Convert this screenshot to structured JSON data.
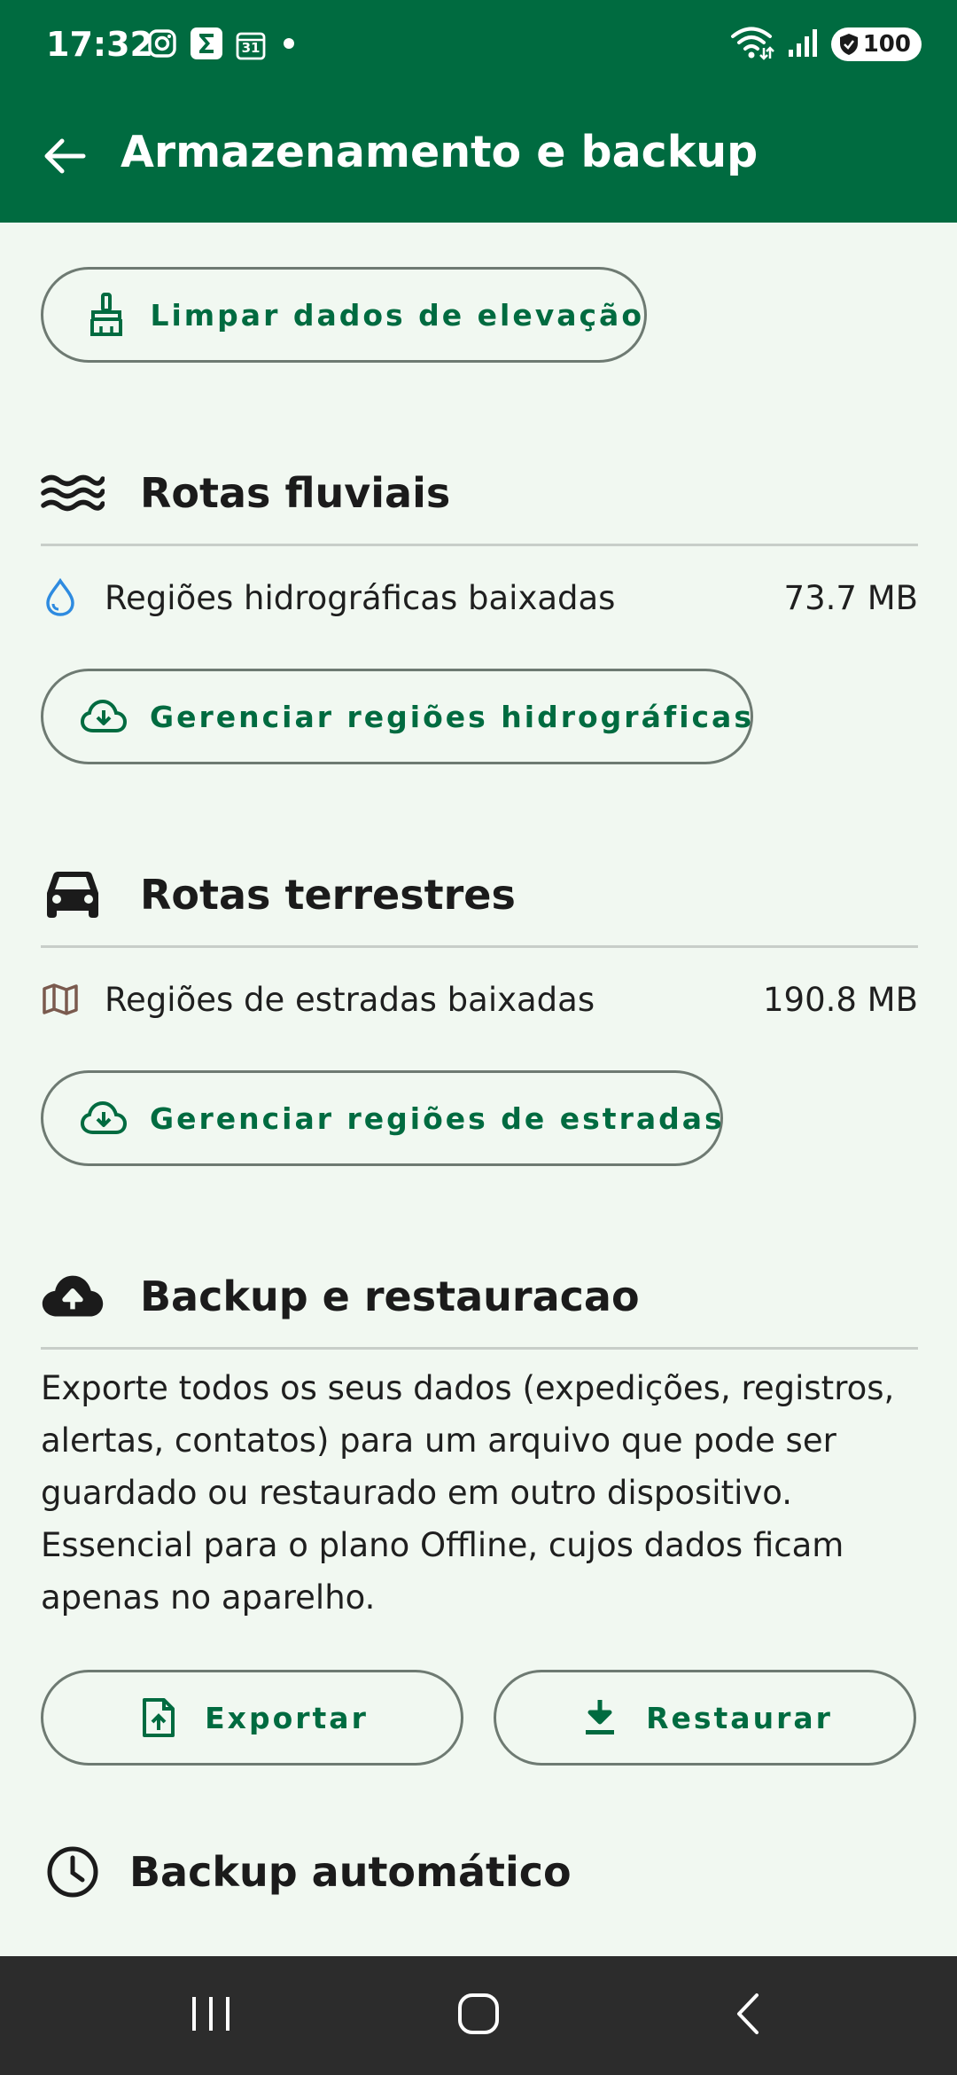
{
  "status_bar": {
    "time": "17:32",
    "battery": "100",
    "left_icons": [
      "instagram-icon",
      "sigma-icon",
      "calendar-icon",
      "dot-icon"
    ],
    "calendar_day": "31",
    "right_icons": [
      "wifi-icon",
      "signal-icon",
      "battery-icon"
    ]
  },
  "app_bar": {
    "title": "Armazenamento e backup",
    "back_icon": "arrow-left-icon"
  },
  "elevation": {
    "clear_button_label": "Limpar dados de elevação",
    "clear_icon": "broom-icon"
  },
  "water_routes": {
    "title": "Rotas fluviais",
    "icon": "waves-icon",
    "row_label": "Regiões hidrográficas baixadas",
    "row_value": "73.7 MB",
    "row_icon": "water-drop-icon",
    "manage_button_label": "Gerenciar regiões hidrográficas",
    "manage_icon": "cloud-download-icon"
  },
  "land_routes": {
    "title": "Rotas terrestres",
    "icon": "car-icon",
    "row_label": "Regiões de estradas baixadas",
    "row_value": "190.8 MB",
    "row_icon": "map-icon",
    "manage_button_label": "Gerenciar regiões de estradas",
    "manage_icon": "cloud-download-icon"
  },
  "backup": {
    "title": "Backup e restauracao",
    "icon": "cloud-upload-icon",
    "description": "Exporte todos os seus dados (expedições, registros, alertas, contatos) para um arquivo que pode ser guardado ou restaurado em outro dispositivo. Essencial para o plano Offline, cujos dados ficam apenas no aparelho.",
    "export_label": "Exportar",
    "export_icon": "file-upload-icon",
    "restore_label": "Restaurar",
    "restore_icon": "download-icon"
  },
  "auto_backup": {
    "title": "Backup automático",
    "icon": "clock-icon"
  },
  "nav_bar": {
    "buttons": [
      "recent-apps-icon",
      "home-icon",
      "back-icon"
    ]
  },
  "colors": {
    "primary": "#006B40",
    "background": "#F1F8F1",
    "outline": "#6E7A72",
    "nav_bar": "#2C2C2C",
    "drop_icon": "#2E8BE0",
    "map_icon": "#7A5A4E"
  }
}
